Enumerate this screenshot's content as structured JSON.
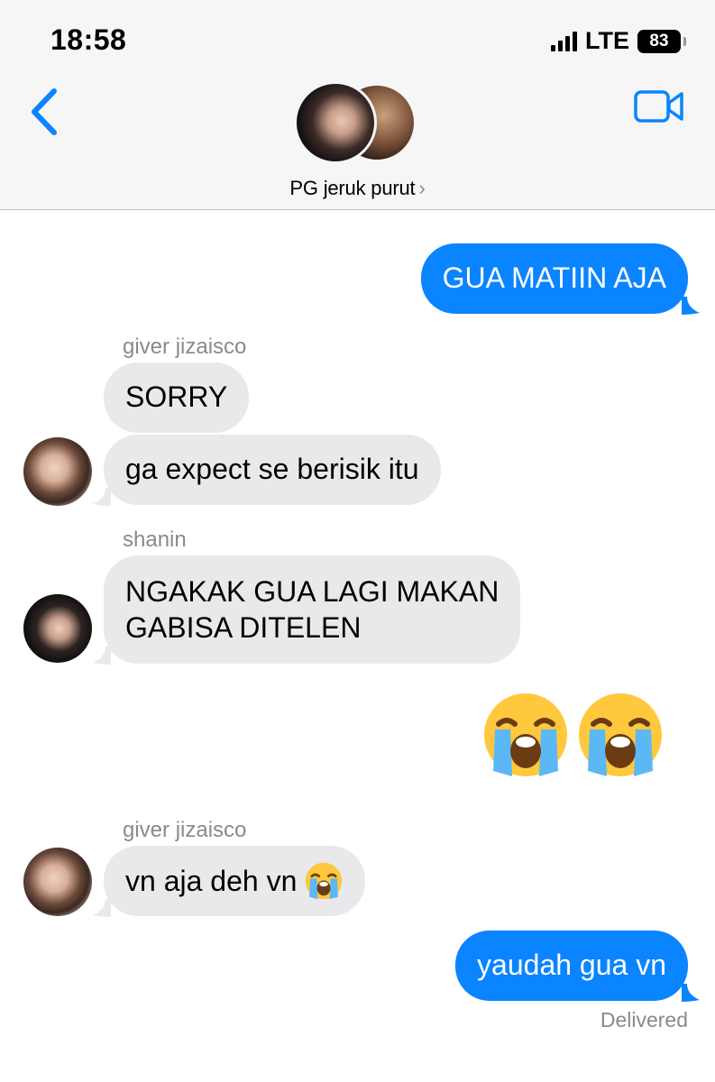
{
  "status_bar": {
    "time": "18:58",
    "network": "LTE",
    "battery": "83"
  },
  "header": {
    "title": "PG jeruk purut",
    "chevron": "›",
    "back_icon": "chevron-left-icon",
    "video_icon": "video-camera-icon"
  },
  "colors": {
    "sent_bubble": "#0a84ff",
    "received_bubble": "#e9e9eb",
    "accent": "#0a84ff",
    "meta_text": "#8a8a8e"
  },
  "messages": [
    {
      "direction": "sent",
      "text": "GUA MATIIN AJA"
    },
    {
      "direction": "received",
      "sender": "giver jizaisco",
      "text": "SORRY"
    },
    {
      "direction": "received",
      "text": "ga expect se berisik itu"
    },
    {
      "direction": "received",
      "sender": "shanin",
      "line1": "NGAKAK GUA LAGI MAKAN",
      "line2": "GABISA DITELEN"
    },
    {
      "direction": "sent",
      "emoji": "loudly-crying-face-icon",
      "count": 2
    },
    {
      "direction": "received",
      "sender": "giver jizaisco",
      "text": "vn aja deh vn",
      "emoji": "loudly-crying-face-icon"
    },
    {
      "direction": "sent",
      "text": "yaudah gua vn",
      "status": "Delivered"
    }
  ]
}
